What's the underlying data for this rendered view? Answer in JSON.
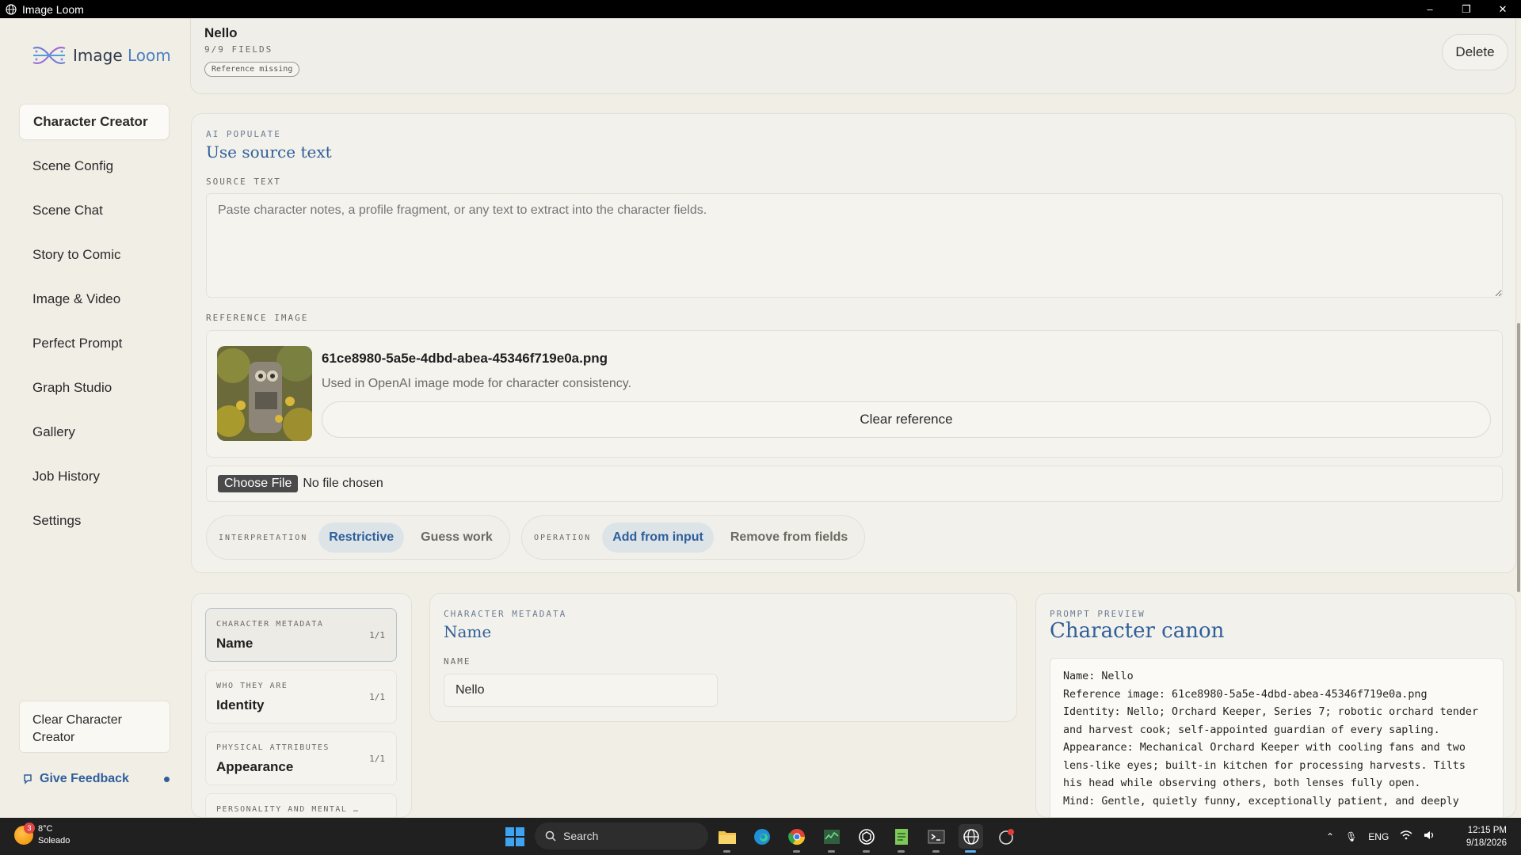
{
  "window": {
    "title": "Image Loom",
    "controls": [
      "–",
      "❐",
      "✕"
    ]
  },
  "logo": {
    "part1": "Image",
    "part2": "Loom"
  },
  "sidebar": {
    "items": [
      {
        "label": "Character Creator",
        "active": true
      },
      {
        "label": "Scene Config"
      },
      {
        "label": "Scene Chat"
      },
      {
        "label": "Story to Comic"
      },
      {
        "label": "Image & Video"
      },
      {
        "label": "Perfect Prompt"
      },
      {
        "label": "Graph Studio"
      },
      {
        "label": "Gallery"
      },
      {
        "label": "Job History"
      },
      {
        "label": "Settings"
      }
    ],
    "clear_button": "Clear Character Creator",
    "feedback": "Give Feedback"
  },
  "header": {
    "name": "Nello",
    "fields": "9/9 FIELDS",
    "badge": "Reference missing",
    "delete": "Delete"
  },
  "ai_populate": {
    "eyebrow": "AI POPULATE",
    "title": "Use source text",
    "source_label": "SOURCE TEXT",
    "source_placeholder": "Paste character notes, a profile fragment, or any text to extract into the character fields.",
    "reference_label": "REFERENCE IMAGE",
    "reference_filename": "61ce8980-5a5e-4dbd-abea-45346f719e0a.png",
    "reference_desc": "Used in OpenAI image mode for character consistency.",
    "clear_reference": "Clear reference",
    "choose_file": "Choose File",
    "no_file": "No file chosen",
    "interpretation": {
      "label": "INTERPRETATION",
      "options": [
        "Restrictive",
        "Guess work"
      ],
      "selected": "Restrictive"
    },
    "operation": {
      "label": "OPERATION",
      "options": [
        "Add from input",
        "Remove from fields"
      ],
      "selected": "Add from input"
    }
  },
  "sections": [
    {
      "eyebrow": "CHARACTER METADATA",
      "name": "Name",
      "count": "1/1",
      "active": true
    },
    {
      "eyebrow": "WHO THEY ARE",
      "name": "Identity",
      "count": "1/1"
    },
    {
      "eyebrow": "PHYSICAL ATTRIBUTES",
      "name": "Appearance",
      "count": "1/1"
    },
    {
      "eyebrow": "PERSONALITY AND MENTAL …",
      "name": "",
      "count": ""
    }
  ],
  "metadata": {
    "eyebrow": "CHARACTER METADATA",
    "title": "Name",
    "field_label": "NAME",
    "field_value": "Nello"
  },
  "preview": {
    "eyebrow": "PROMPT PREVIEW",
    "title": "Character canon",
    "text": "Name: Nello\nReference image: 61ce8980-5a5e-4dbd-abea-45346f719e0a.png\nIdentity: Nello; Orchard Keeper, Series 7; robotic orchard tender and harvest cook; self-appointed guardian of every sapling.\nAppearance: Mechanical Orchard Keeper with cooling fans and two lens-like eyes; built-in kitchen for processing harvests. Tilts his head while observing others, both lenses fully open.\nMind: Gentle, quietly funny, exceptionally patient, and deeply"
  },
  "taskbar": {
    "weather_temp": "8°C",
    "weather_desc": "Soleado",
    "weather_badge": "3",
    "search": "Search",
    "lang": "ENG",
    "time": "12:15 PM",
    "date": "9/18/2026"
  }
}
